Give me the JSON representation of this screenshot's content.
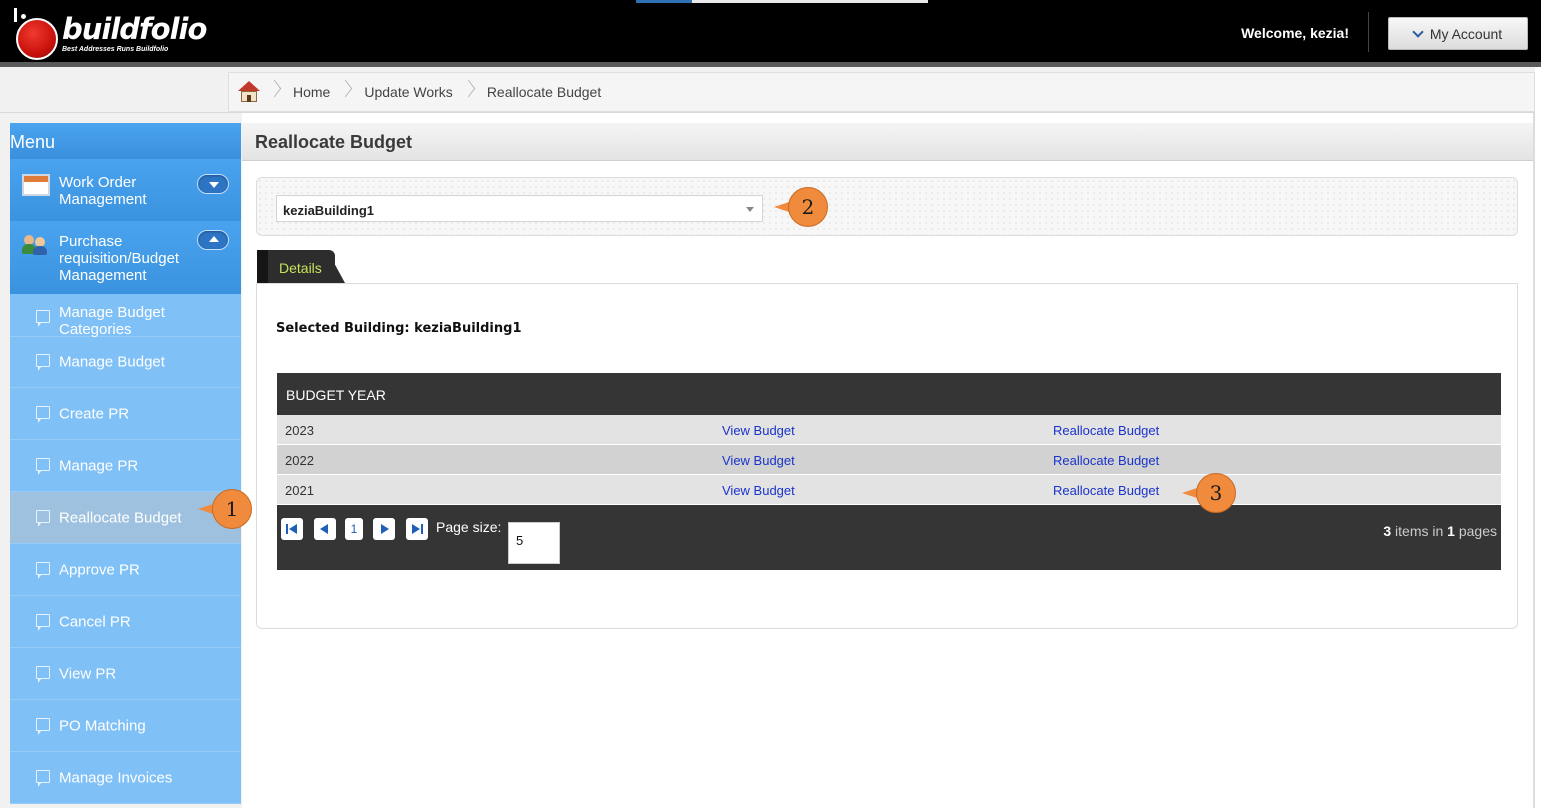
{
  "header": {
    "logo_text": "buildfolio",
    "logo_tagline": "Best Addresses Runs Buildfolio",
    "welcome": "Welcome, kezia!",
    "account_label": "My Account"
  },
  "breadcrumb": {
    "items": [
      "Home",
      "Update Works",
      "Reallocate Budget"
    ]
  },
  "sidebar": {
    "title": "Menu",
    "groups": [
      {
        "label": "Work Order Management",
        "icon": "window-icon",
        "expanded": false
      },
      {
        "label": "Purchase requisition/Budget Management",
        "icon": "people-icon",
        "expanded": true
      }
    ],
    "items": [
      {
        "label": "Manage Budget Categories"
      },
      {
        "label": "Manage Budget"
      },
      {
        "label": "Create PR"
      },
      {
        "label": "Manage PR"
      },
      {
        "label": "Reallocate Budget",
        "active": true
      },
      {
        "label": "Approve PR"
      },
      {
        "label": "Cancel PR"
      },
      {
        "label": "View PR"
      },
      {
        "label": "PO Matching"
      },
      {
        "label": "Manage Invoices"
      }
    ]
  },
  "main": {
    "title": "Reallocate Budget",
    "building_select": {
      "value": "keziaBuilding1"
    },
    "tab_label": "Details",
    "selected_building_label": "Selected Building: keziaBuilding1",
    "grid": {
      "header": "BUDGET YEAR",
      "rows": [
        {
          "year": "2023",
          "view": "View Budget",
          "reallocate": "Reallocate Budget"
        },
        {
          "year": "2022",
          "view": "View Budget",
          "reallocate": "Reallocate Budget"
        },
        {
          "year": "2021",
          "view": "View Budget",
          "reallocate": "Reallocate Budget"
        }
      ],
      "pager": {
        "current_page": "1",
        "page_size_label": "Page size:",
        "page_size": "5",
        "items_count": "3",
        "items_text": "items in",
        "pages_count": "1",
        "pages_text": "pages"
      }
    }
  },
  "callouts": [
    "1",
    "2",
    "3"
  ],
  "colors": {
    "menu_blue": "#3a8fdc",
    "submenu_blue": "#7fc0f6",
    "callout_orange": "#f08a3c",
    "link_blue": "#1a33c9",
    "tab_text": "#c5e45a"
  }
}
